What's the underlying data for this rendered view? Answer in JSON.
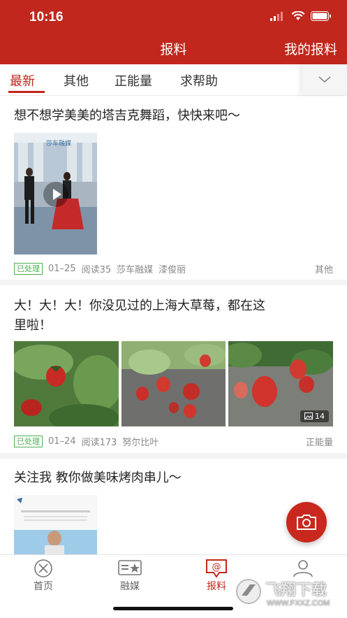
{
  "status_bar": {
    "time": "10:16"
  },
  "header": {
    "title": "报料",
    "my_reports": "我的报料"
  },
  "tabs": [
    {
      "label": "最新",
      "active": true
    },
    {
      "label": "其他"
    },
    {
      "label": "正能量"
    },
    {
      "label": "求帮助"
    }
  ],
  "posts": [
    {
      "title": "想不想学美美的塔吉克舞蹈，快快来吧～",
      "badge": "已处理",
      "date": "01–25",
      "reads": "阅读35",
      "org": "莎车融媒",
      "author": "漆俊丽",
      "category": "其他",
      "video_watermark": "莎车融媒"
    },
    {
      "title_line1": "大！大！大！你没见过的上海大草莓，都在这",
      "title_line2": "里啦！",
      "badge": "已处理",
      "date": "01–24",
      "reads": "阅读173",
      "author": "努尔比叶",
      "category": "正能量",
      "image_count": "14"
    },
    {
      "title": "关注我 教你做美味烤肉串儿～"
    }
  ],
  "tabbar": [
    {
      "label": "首页"
    },
    {
      "label": "融媒"
    },
    {
      "label": "报料",
      "active": true
    },
    {
      "label": ""
    }
  ],
  "watermark": {
    "text": "飞翔下载",
    "url": "WWW.FXXZ.COM"
  },
  "colors": {
    "brand_red": "#c1271d",
    "processed_green": "#4caf50"
  }
}
